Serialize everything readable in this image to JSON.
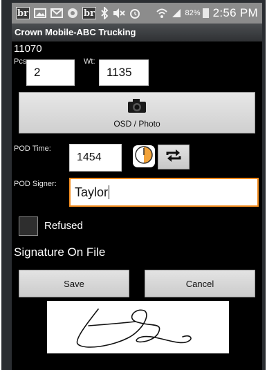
{
  "status_bar": {
    "icons": [
      "br-icon",
      "image-icon",
      "mail-icon",
      "chrome-icon",
      "br-icon",
      "bluetooth-icon",
      "mute-icon",
      "alarm-icon",
      "wifi-icon",
      "signal-icon"
    ],
    "br_text": "br",
    "battery_pct": "82%",
    "time": "2:56 PM"
  },
  "app": {
    "title": "Crown Mobile-ABC Trucking"
  },
  "form": {
    "order_number": "11070",
    "pcs_label": "Pcs:",
    "pcs_value": "2",
    "wt_label": "Wt:",
    "wt_value": "1135",
    "osd_button_label": "OSD / Photo",
    "pod_time_label": "POD Time:",
    "pod_time_value": "1454",
    "pod_signer_label": "POD Signer:",
    "pod_signer_value": "Taylor",
    "refused_label": "Refused",
    "refused_checked": false,
    "signature_on_file_label": "Signature On File",
    "save_label": "Save",
    "cancel_label": "Cancel"
  },
  "colors": {
    "status_bar_bg": "#8c8c8c",
    "title_bar_bg": "#3a3c3f",
    "focus_border": "#f28c1e",
    "screen_bg": "#000000"
  }
}
